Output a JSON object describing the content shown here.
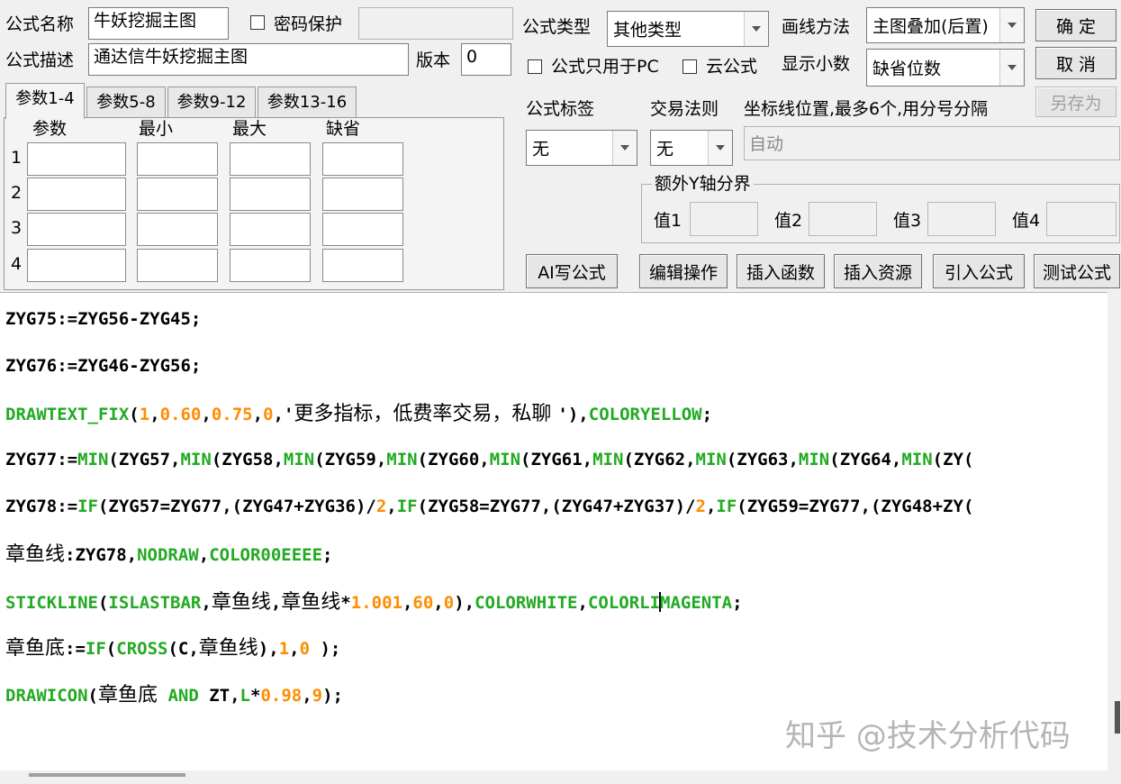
{
  "form": {
    "name_label": "公式名称",
    "name_value": "牛妖挖掘主图",
    "password_label": "密码保护",
    "password_value": "",
    "desc_label": "公式描述",
    "desc_value": "通达信牛妖挖掘主图",
    "version_label": "版本",
    "version_value": "0"
  },
  "tabs": [
    {
      "label": "参数1-4"
    },
    {
      "label": "参数5-8"
    },
    {
      "label": "参数9-12"
    },
    {
      "label": "参数13-16"
    }
  ],
  "params": {
    "headers": [
      "参数",
      "最小",
      "最大",
      "缺省"
    ],
    "rows": [
      "1",
      "2",
      "3",
      "4"
    ]
  },
  "settings": {
    "type_label": "公式类型",
    "type_value": "其他类型",
    "draw_label": "画线方法",
    "draw_value": "主图叠加(后置)",
    "pc_only_label": "公式只用于PC",
    "cloud_label": "云公式",
    "decimals_label": "显示小数",
    "decimals_value": "缺省位数",
    "tag_label": "公式标签",
    "tag_value": "无",
    "rule_label": "交易法则",
    "rule_value": "无",
    "coord_label": "坐标线位置,最多6个,用分号分隔",
    "coord_value": "自动",
    "yaxis_group_label": "额外Y轴分界",
    "yaxis_values": [
      "值1",
      "值2",
      "值3",
      "值4"
    ]
  },
  "buttons": {
    "ok": "确 定",
    "cancel": "取 消",
    "save_as": "另存为",
    "ai": "AI写公式",
    "edit": "编辑操作",
    "insert_fn": "插入函数",
    "insert_res": "插入资源",
    "import": "引入公式",
    "test": "测试公式"
  },
  "code_lines": [
    [
      [
        "t",
        "ZYG75:=ZYG56-ZYG45;"
      ]
    ],
    [
      [
        "t",
        "ZYG76:=ZYG46-ZYG56;"
      ]
    ],
    [
      [
        "f",
        "DRAWTEXT_FIX"
      ],
      [
        "t",
        "("
      ],
      [
        "n",
        "1"
      ],
      [
        "t",
        ","
      ],
      [
        "n",
        "0.60"
      ],
      [
        "t",
        ","
      ],
      [
        "n",
        "0.75"
      ],
      [
        "t",
        ","
      ],
      [
        "n",
        "0"
      ],
      [
        "t",
        ",'"
      ],
      [
        "c",
        "更多指标，低费率交易，私聊 "
      ],
      [
        "t",
        "'),"
      ],
      [
        "f",
        "COLORYELLOW"
      ],
      [
        "t",
        ";"
      ]
    ],
    [
      [
        "t",
        "ZYG77:="
      ],
      [
        "f",
        "MIN"
      ],
      [
        "t",
        "(ZYG57,"
      ],
      [
        "f",
        "MIN"
      ],
      [
        "t",
        "(ZYG58,"
      ],
      [
        "f",
        "MIN"
      ],
      [
        "t",
        "(ZYG59,"
      ],
      [
        "f",
        "MIN"
      ],
      [
        "t",
        "(ZYG60,"
      ],
      [
        "f",
        "MIN"
      ],
      [
        "t",
        "(ZYG61,"
      ],
      [
        "f",
        "MIN"
      ],
      [
        "t",
        "(ZYG62,"
      ],
      [
        "f",
        "MIN"
      ],
      [
        "t",
        "(ZYG63,"
      ],
      [
        "f",
        "MIN"
      ],
      [
        "t",
        "(ZYG64,"
      ],
      [
        "f",
        "MIN"
      ],
      [
        "t",
        "(ZY("
      ]
    ],
    [
      [
        "t",
        "ZYG78:="
      ],
      [
        "f",
        "IF"
      ],
      [
        "t",
        "(ZYG57=ZYG77,(ZYG47+ZYG36)/"
      ],
      [
        "n",
        "2"
      ],
      [
        "t",
        ","
      ],
      [
        "f",
        "IF"
      ],
      [
        "t",
        "(ZYG58=ZYG77,(ZYG47+ZYG37)/"
      ],
      [
        "n",
        "2"
      ],
      [
        "t",
        ","
      ],
      [
        "f",
        "IF"
      ],
      [
        "t",
        "(ZYG59=ZYG77,(ZYG48+ZY("
      ]
    ],
    [
      [
        "c",
        "章鱼线"
      ],
      [
        "t",
        ":ZYG78,"
      ],
      [
        "f",
        "NODRAW"
      ],
      [
        "t",
        ","
      ],
      [
        "f",
        "COLOR00EEEE"
      ],
      [
        "t",
        ";"
      ]
    ],
    [
      [
        "f",
        "STICKLINE"
      ],
      [
        "t",
        "("
      ],
      [
        "f",
        "ISLASTBAR"
      ],
      [
        "t",
        ","
      ],
      [
        "c",
        "章鱼线"
      ],
      [
        "t",
        ","
      ],
      [
        "c",
        "章鱼线"
      ],
      [
        "t",
        "*"
      ],
      [
        "n",
        "1.001"
      ],
      [
        "t",
        ","
      ],
      [
        "n",
        "60"
      ],
      [
        "t",
        ","
      ],
      [
        "n",
        "0"
      ],
      [
        "t",
        "),"
      ],
      [
        "f",
        "COLORWHITE"
      ],
      [
        "t",
        ","
      ],
      [
        "f",
        "COLORLI"
      ],
      [
        "k",
        ""
      ],
      [
        "f",
        "MAGENTA"
      ],
      [
        "t",
        ";"
      ]
    ],
    [
      [
        "c",
        "章鱼底"
      ],
      [
        "t",
        ":="
      ],
      [
        "f",
        "IF"
      ],
      [
        "t",
        "("
      ],
      [
        "f",
        "CROSS"
      ],
      [
        "t",
        "(C,"
      ],
      [
        "c",
        "章鱼线"
      ],
      [
        "t",
        "),"
      ],
      [
        "n",
        "1"
      ],
      [
        "t",
        ","
      ],
      [
        "n",
        "0"
      ],
      [
        "t",
        " );"
      ]
    ],
    [
      [
        "f",
        "DRAWICON"
      ],
      [
        "t",
        "("
      ],
      [
        "c",
        "章鱼底"
      ],
      [
        "t",
        " "
      ],
      [
        "f",
        "AND"
      ],
      [
        "t",
        " ZT,"
      ],
      [
        "f",
        "L"
      ],
      [
        "t",
        "*"
      ],
      [
        "n",
        "0.98"
      ],
      [
        "t",
        ","
      ],
      [
        "n",
        "9"
      ],
      [
        "t",
        ");"
      ]
    ]
  ],
  "watermark": "知乎 @技术分析代码"
}
